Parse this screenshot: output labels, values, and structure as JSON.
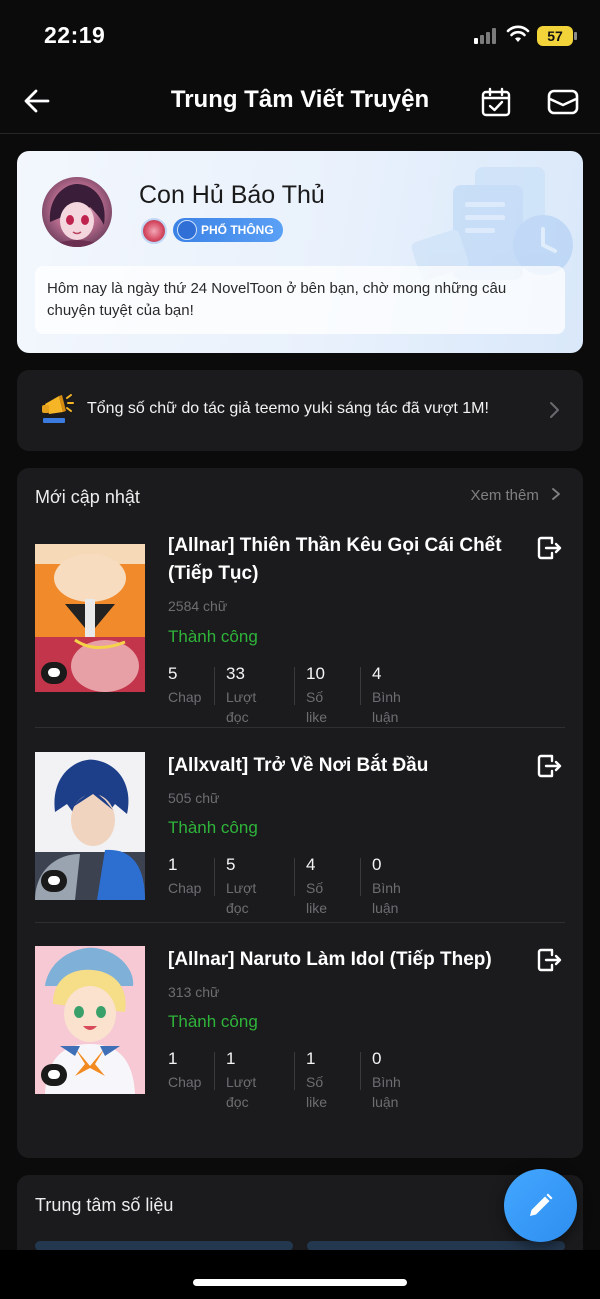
{
  "status_bar": {
    "time": "22:19",
    "battery": "57"
  },
  "nav": {
    "title": "Trung Tâm Viết Truyện"
  },
  "profile": {
    "author_name": "Con Hủ Báo Thủ",
    "level_badge": "PHỔ THÔNG",
    "message": "Hôm nay là ngày thứ 24 NovelToon ở bên bạn, chờ mong những câu chuyện tuyệt của bạn!"
  },
  "announcement": {
    "text": "Tổng số chữ do tác giả teemo yuki sáng tác đã vượt 1M!"
  },
  "updates": {
    "title": "Mới cập nhật",
    "see_more": "Xem thêm",
    "stories": [
      {
        "title": "[Allnar] Thiên Thần Kêu Gọi Cái Chết (Tiếp Tục)",
        "words": "2584 chữ",
        "status": "Thành công",
        "stats": [
          {
            "value": "5",
            "label": "Chap"
          },
          {
            "value": "33",
            "label": "Lượt đọc"
          },
          {
            "value": "10",
            "label": "Số like"
          },
          {
            "value": "4",
            "label": "Bình luận"
          }
        ]
      },
      {
        "title": "[Allxvalt] Trở Về Nơi Bắt Đầu",
        "words": "505 chữ",
        "status": "Thành công",
        "stats": [
          {
            "value": "1",
            "label": "Chap"
          },
          {
            "value": "5",
            "label": "Lượt đọc"
          },
          {
            "value": "4",
            "label": "Số like"
          },
          {
            "value": "0",
            "label": "Bình luận"
          }
        ]
      },
      {
        "title": "[Allnar] Naruto Làm Idol (Tiếp Thep)",
        "words": "313 chữ",
        "status": "Thành công",
        "stats": [
          {
            "value": "1",
            "label": "Chap"
          },
          {
            "value": "1",
            "label": "Lượt đọc"
          },
          {
            "value": "1",
            "label": "Số like"
          },
          {
            "value": "0",
            "label": "Bình luận"
          }
        ]
      }
    ]
  },
  "stats_center": {
    "title": "Trung tâm số liệu"
  },
  "icons": {
    "back": "back-arrow-icon",
    "calendar": "calendar-check-icon",
    "mail": "mail-icon",
    "announce": "megaphone-icon",
    "action": "exit-door-icon",
    "fab": "pencil-icon"
  },
  "colors": {
    "accent": "#3b9cff",
    "success": "#2fb43a",
    "card": "#1b1b1d",
    "background": "#0b0b0c"
  }
}
